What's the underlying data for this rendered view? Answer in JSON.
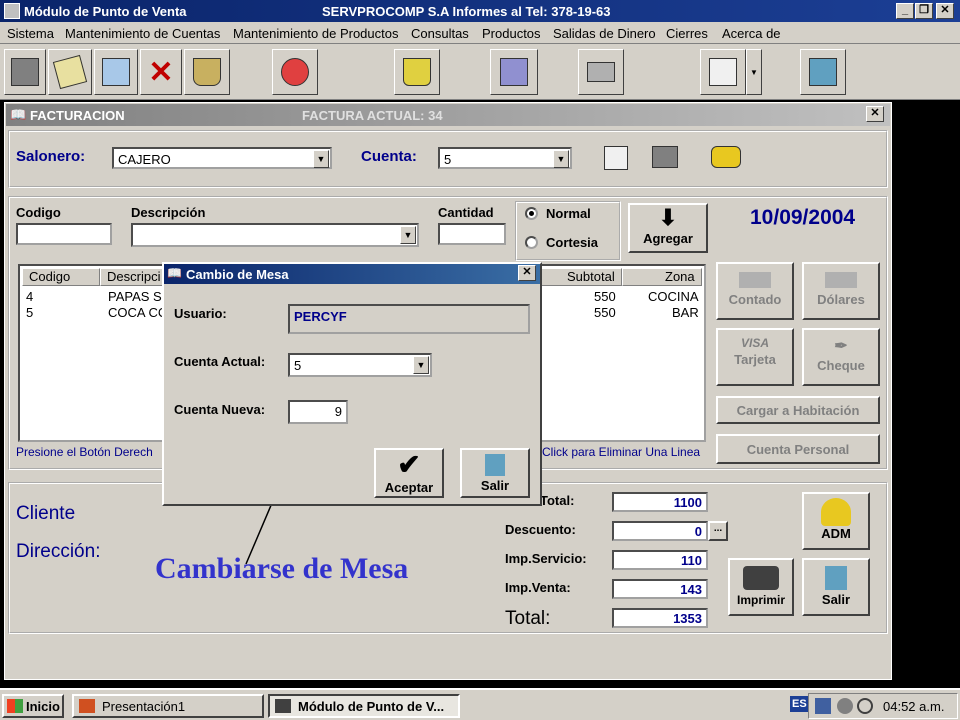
{
  "window": {
    "title": "Módulo de Punto de Venta",
    "center_title": "SERVPROCOMP S.A  Informes al Tel:  378-19-63"
  },
  "menu": [
    "Sistema",
    "Mantenimiento de Cuentas",
    "Mantenimiento de Productos",
    "Consultas",
    "Productos",
    "Salidas de Dinero",
    "Cierres",
    "Acerca de"
  ],
  "toolbar": {
    "icons": [
      "register-icon",
      "edit-icon",
      "signature-icon",
      "delete-icon",
      "basket-icon",
      "game-icon",
      "trash-icon",
      "notebook-icon",
      "printer-icon",
      "calculator-icon",
      "exit-icon"
    ]
  },
  "form": {
    "title": "FACTURACION",
    "current_invoice": "FACTURA ACTUAL:  34",
    "salonero_label": "Salonero:",
    "salonero_value": "CAJERO",
    "cuenta_label": "Cuenta:",
    "cuenta_value": "5",
    "codigo_label": "Codigo",
    "descripcion_label": "Descripción",
    "cantidad_label": "Cantidad",
    "normal_label": "Normal",
    "cortesia_label": "Cortesia",
    "agregar_label": "Agregar",
    "date": "10/09/2004",
    "grid_headers": [
      "Codigo",
      "Descripci",
      "Subtotal",
      "Zona"
    ],
    "grid_rows": [
      {
        "codigo": "4",
        "descripcion": "PAPAS S",
        "subtotal": "550",
        "zona": "COCINA"
      },
      {
        "codigo": "5",
        "descripcion": "COCA CC",
        "subtotal": "550",
        "zona": "BAR"
      }
    ],
    "hint_left": "Presione el Botón Derech",
    "hint_right": "Click para Eliminar Una Linea",
    "payment_buttons": {
      "contado": "Contado",
      "dolares": "Dólares",
      "tarjeta": "Tarjeta",
      "cheque": "Cheque",
      "cargar": "Cargar a Habitación",
      "cuenta_personal": "Cuenta Personal"
    },
    "cliente_label": "Cliente",
    "direccion_label": "Dirección:",
    "totals": {
      "total_label": "Total:",
      "total_value": "1100",
      "descuento_label": "Descuento:",
      "descuento_value": "0",
      "servicio_label": "Imp.Servicio:",
      "servicio_value": "110",
      "venta_label": "Imp.Venta:",
      "venta_value": "143",
      "grand_label": "Total:",
      "grand_value": "1353"
    },
    "adm_label": "ADM",
    "imprimir_label": "Imprimir",
    "salir_label": "Salir"
  },
  "dialog": {
    "title": "Cambio de Mesa",
    "usuario_label": "Usuario:",
    "usuario_value": "PERCYF",
    "cuenta_actual_label": "Cuenta Actual:",
    "cuenta_actual_value": "5",
    "cuenta_nueva_label": "Cuenta Nueva:",
    "cuenta_nueva_value": "9",
    "aceptar_label": "Aceptar",
    "salir_label": "Salir"
  },
  "annotation": "Cambiarse de Mesa",
  "taskbar": {
    "start": "Inicio",
    "task1": "Presentación1",
    "task2": "Módulo de Punto de V...",
    "lang": "ES",
    "clock": "04:52 a.m."
  }
}
